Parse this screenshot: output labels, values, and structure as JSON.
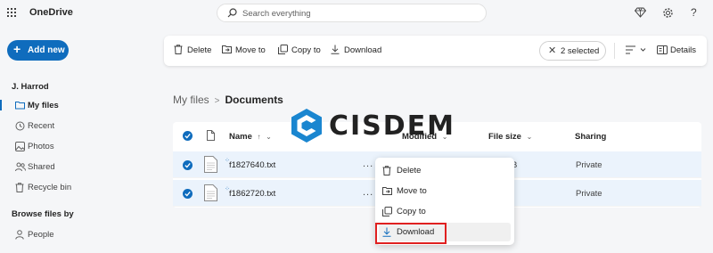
{
  "header": {
    "app_title": "OneDrive",
    "search_placeholder": "Search everything",
    "icons": [
      "waffle-icon",
      "search-icon",
      "diamond-icon",
      "gear-icon",
      "help-icon"
    ],
    "help_glyph": "?"
  },
  "sidebar": {
    "add_new_label": "Add new",
    "user_name": "J. Harrod",
    "items": [
      {
        "label": "My files",
        "icon": "folder-icon",
        "active": true
      },
      {
        "label": "Recent",
        "icon": "clock-icon"
      },
      {
        "label": "Photos",
        "icon": "photo-icon"
      },
      {
        "label": "Shared",
        "icon": "people-icon"
      },
      {
        "label": "Recycle bin",
        "icon": "trash-icon"
      }
    ],
    "browse_heading": "Browse files by",
    "browse_items": [
      {
        "label": "People",
        "icon": "person-icon"
      }
    ]
  },
  "toolbar": {
    "delete_label": "Delete",
    "move_label": "Move to",
    "copy_label": "Copy to",
    "download_label": "Download",
    "selected_label": "2 selected",
    "details_label": "Details"
  },
  "breadcrumb": {
    "root": "My files",
    "separator": ">",
    "current": "Documents"
  },
  "file_list": {
    "columns": {
      "name": "Name",
      "name_sort": "↑",
      "modified": "Modified",
      "file_size": "File size",
      "sharing": "Sharing"
    },
    "rows": [
      {
        "name": "f1827640.txt",
        "size": "B",
        "sharing": "Private",
        "selected": true
      },
      {
        "name": "f1862720.txt",
        "size": "",
        "sharing": "Private",
        "selected": true
      }
    ],
    "more_glyph": "..."
  },
  "context_menu": {
    "items": [
      {
        "label": "Delete",
        "icon": "trash-icon"
      },
      {
        "label": "Move to",
        "icon": "move-icon"
      },
      {
        "label": "Copy to",
        "icon": "copy-icon"
      },
      {
        "label": "Download",
        "icon": "download-icon",
        "highlighted": true
      }
    ]
  },
  "watermark": {
    "text": "CISDEM"
  },
  "colors": {
    "accent": "#0f6cbd",
    "highlight_box": "#e02020",
    "row_selected": "#ebf3fc"
  }
}
